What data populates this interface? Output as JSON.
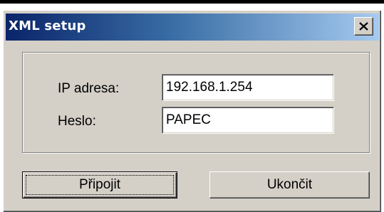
{
  "window": {
    "title": "XML setup"
  },
  "form": {
    "ip_label": "IP adresa:",
    "ip_value": "192.168.1.254",
    "password_label": "Heslo:",
    "password_value": "PAPEC"
  },
  "buttons": {
    "connect_label": "Připojit",
    "quit_label": "Ukončit"
  },
  "icons": {
    "close": "close-icon"
  },
  "colors": {
    "dialog_face": "#d4d0c8",
    "titlebar_start": "#0a246a",
    "titlebar_end": "#a6caf0",
    "title_text": "#ffffff"
  }
}
